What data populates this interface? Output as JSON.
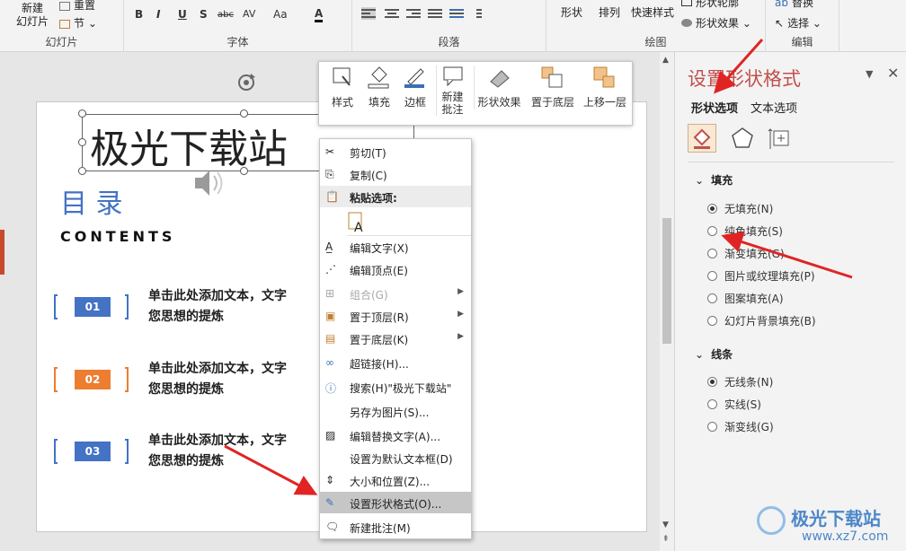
{
  "ribbon": {
    "slides_group": {
      "new_slide": "新建\n幻灯片",
      "reset": "重置",
      "section": "节",
      "label": "幻灯片"
    },
    "font_group": {
      "label": "字体",
      "bold": "B",
      "italic": "I",
      "underline": "U",
      "shadow": "S",
      "strike": "abc",
      "spacing": "AV",
      "case": "Aa",
      "color": "A"
    },
    "paragraph_group": {
      "label": "段落"
    },
    "drawing_group": {
      "shape": "形状",
      "arrange": "排列",
      "quick_styles": "快速样式",
      "outline": "形状轮廓",
      "effects": "形状效果",
      "label": "绘图"
    },
    "editing_group": {
      "replace": "替换",
      "select": "选择",
      "label": "编辑"
    }
  },
  "slide": {
    "title": "极光下载站",
    "toc_heading": "目 录",
    "contents": "CONTENTS",
    "items": [
      {
        "num": "01",
        "line1": "单击此处添加文本，文字",
        "line2": "您思想的提炼",
        "color": "#4472c4"
      },
      {
        "num": "02",
        "line1": "单击此处添加文本，文字",
        "line2": "您思想的提炼",
        "color": "#ed7d31"
      },
      {
        "num": "03",
        "line1": "单击此处添加文本，文字",
        "line2": "您思想的提炼",
        "color": "#4472c4"
      }
    ]
  },
  "mini_toolbar": {
    "style": "样式",
    "fill": "填充",
    "border": "边框",
    "new_comment": "新建\n批注",
    "shape_effects": "形状效果",
    "send_back": "置于底层",
    "bring_forward": "上移一层"
  },
  "context_menu": {
    "cut": "剪切(T)",
    "copy": "复制(C)",
    "paste_options": "粘贴选项:",
    "edit_text": "编辑文字(X)",
    "edit_points": "编辑顶点(E)",
    "group": "组合(G)",
    "bring_front": "置于顶层(R)",
    "send_bottom": "置于底层(K)",
    "hyperlink": "超链接(H)...",
    "search": "搜索(H)\"极光下载站\"",
    "save_as_picture": "另存为图片(S)...",
    "edit_alt_text": "编辑替换文字(A)...",
    "set_default_textbox": "设置为默认文本框(D)",
    "size_position": "大小和位置(Z)...",
    "format_shape": "设置形状格式(O)...",
    "new_comment": "新建批注(M)"
  },
  "pane": {
    "title": "设置形状格式",
    "tab_shape": "形状选项",
    "tab_text": "文本选项",
    "fill_section": "填充",
    "fill_options": [
      {
        "label": "无填充(N)",
        "selected": true
      },
      {
        "label": "纯色填充(S)",
        "selected": false
      },
      {
        "label": "渐变填充(G)",
        "selected": false
      },
      {
        "label": "图片或纹理填充(P)",
        "selected": false
      },
      {
        "label": "图案填充(A)",
        "selected": false
      },
      {
        "label": "幻灯片背景填充(B)",
        "selected": false
      }
    ],
    "line_section": "线条",
    "line_options": [
      {
        "label": "无线条(N)",
        "selected": true
      },
      {
        "label": "实线(S)",
        "selected": false
      },
      {
        "label": "渐变线(G)",
        "selected": false
      }
    ]
  },
  "watermark": {
    "text": "极光下载站",
    "url": "www.xz7.com"
  },
  "colors": {
    "accent_red": "#c0504d",
    "arrow": "#e02424",
    "blue": "#4472c4",
    "orange": "#ed7d31"
  }
}
